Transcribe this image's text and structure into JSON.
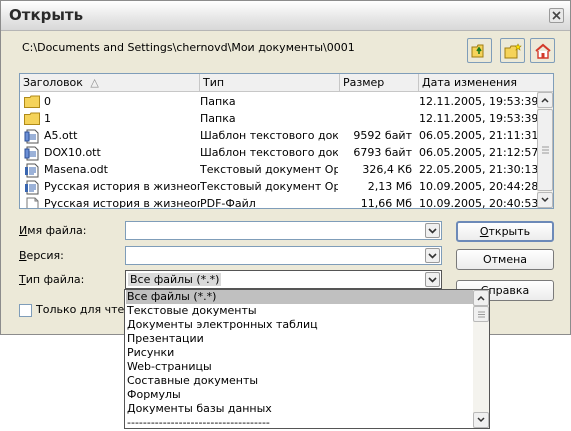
{
  "window": {
    "title": "Открыть",
    "path": "C:\\Documents and Settings\\chernovd\\Мои документы\\0001"
  },
  "toolbar": {
    "up_icon": "folder-up-icon",
    "new_folder_icon": "new-folder-icon",
    "home_icon": "home-icon"
  },
  "file_list": {
    "columns": [
      "Заголовок",
      "Тип",
      "Размер",
      "Дата изменения"
    ],
    "sort_indicator": "△",
    "rows": [
      {
        "icon": "folder-icon",
        "name": "0",
        "type": "Папка",
        "size": "",
        "date": "12.11.2005, 19:53:39"
      },
      {
        "icon": "folder-icon",
        "name": "1",
        "type": "Папка",
        "size": "",
        "date": "12.11.2005, 19:53:39"
      },
      {
        "icon": "template-icon",
        "name": "A5.ott",
        "type": "Шаблон текстового доку",
        "size": "9592 байт",
        "date": "06.05.2005, 21:11:31"
      },
      {
        "icon": "template-icon",
        "name": "DOX10.ott",
        "type": "Шаблон текстового доку",
        "size": "6793 байт",
        "date": "06.05.2005, 21:12:57"
      },
      {
        "icon": "document-icon",
        "name": "Masena.odt",
        "type": "Текстовый документ Opei",
        "size": "326,4 Кб",
        "date": "22.05.2005, 21:30:13"
      },
      {
        "icon": "document-icon",
        "name": "Русская история в жизнеопис",
        "type": "Текстовый документ Opei",
        "size": "2,13 Мб",
        "date": "10.09.2005, 20:44:28"
      },
      {
        "icon": "pdf-icon",
        "name": "Русская история в жизнеопис",
        "type": "PDF-Файл",
        "size": "11,66 Мб",
        "date": "10.09.2005, 20:40:53"
      }
    ]
  },
  "form": {
    "filename_label": "Имя файла:",
    "filename_value": "",
    "version_label": "Версия:",
    "version_value": "",
    "filetype_label": "Тип файла:",
    "filetype_value": "Все файлы (*.*)",
    "readonly_label": "Только для чтени"
  },
  "buttons": {
    "open": "Открыть",
    "cancel": "Отмена",
    "help": "Справка"
  },
  "dropdown": {
    "items": [
      "Все файлы (*.*)",
      "Текстовые документы",
      "Документы электронных таблиц",
      "Презентации",
      "Рисунки",
      "Web-страницы",
      "Составные документы",
      "Формулы",
      "Документы базы данных",
      "------------------------------------"
    ],
    "selected_index": 0
  },
  "colors": {
    "dialog_bg": "#ece9d8",
    "field_border": "#7f9db9",
    "folder": "#f5d35a",
    "home_red": "#d33a2a",
    "selection": "#c0c0c0"
  }
}
